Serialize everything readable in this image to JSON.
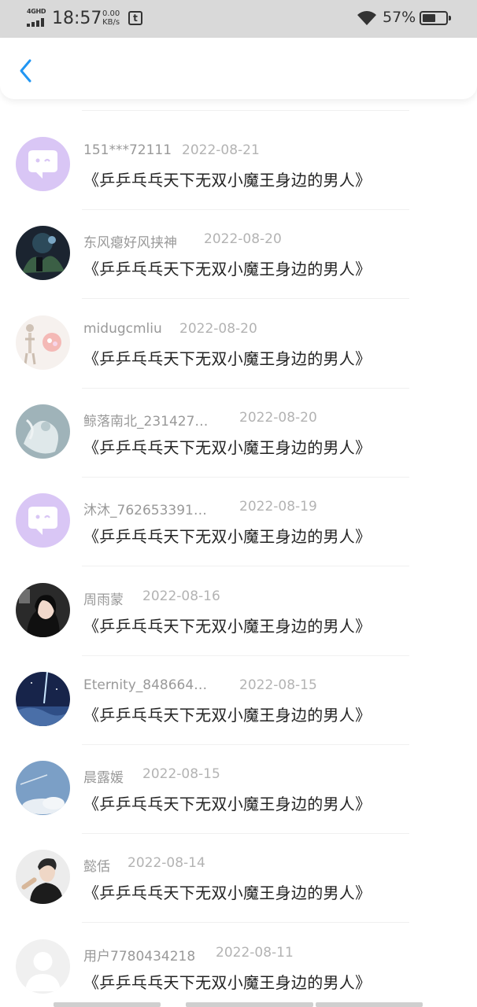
{
  "status_bar": {
    "network": "4GHD",
    "time": "18:57",
    "speed_value": "0.00",
    "speed_unit": "KB/s",
    "battery": "57%",
    "icons": [
      "signal-icon",
      "t-app-icon",
      "wifi-icon",
      "battery-icon"
    ]
  },
  "nav": {
    "back_icon": "chevron-left-icon",
    "accent_color": "#2196f3"
  },
  "comments": [
    {
      "user": "151***72111",
      "date": "2022-08-21",
      "text": "《乒乒乓乓天下无双小魔王身边的男人》",
      "avatar": "chat-bubble-avatar"
    },
    {
      "user": "东风瘪好风挟神",
      "date": "2022-08-20",
      "text": "《乒乒乓乓天下无双小魔王身边的男人》",
      "avatar": "photo-avatar"
    },
    {
      "user": "midugcmliu",
      "date": "2022-08-20",
      "text": "《乒乒乓乓天下无双小魔王身边的男人》",
      "avatar": "photo-avatar"
    },
    {
      "user": "鲸落南北_231427…",
      "date": "2022-08-20",
      "text": "《乒乒乓乓天下无双小魔王身边的男人》",
      "avatar": "photo-avatar"
    },
    {
      "user": "沐沐_762653391…",
      "date": "2022-08-19",
      "text": "《乒乒乓乓天下无双小魔王身边的男人》",
      "avatar": "chat-bubble-avatar"
    },
    {
      "user": "周雨蒙",
      "date": "2022-08-16",
      "text": "《乒乒乓乓天下无双小魔王身边的男人》",
      "avatar": "photo-avatar"
    },
    {
      "user": "Eternity_848664…",
      "date": "2022-08-15",
      "text": "《乒乒乓乓天下无双小魔王身边的男人》",
      "avatar": "photo-avatar"
    },
    {
      "user": "晨露媛",
      "date": "2022-08-15",
      "text": "《乒乒乓乓天下无双小魔王身边的男人》",
      "avatar": "photo-avatar"
    },
    {
      "user": "懿佸",
      "date": "2022-08-14",
      "text": "《乒乒乓乓天下无双小魔王身边的男人》",
      "avatar": "photo-avatar"
    },
    {
      "user": "用户7780434218",
      "date": "2022-08-11",
      "text": "《乒乒乓乓天下无双小魔王身边的男人》",
      "avatar": "default-user-avatar"
    }
  ]
}
